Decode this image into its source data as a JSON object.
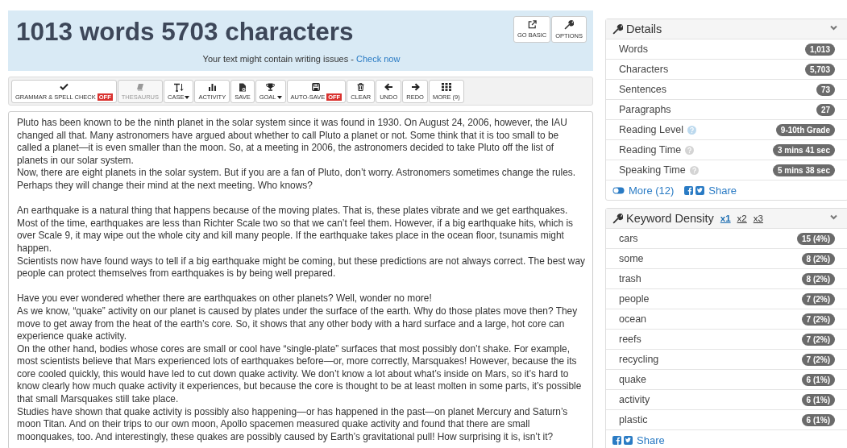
{
  "header": {
    "title": "1013 words 5703 characters",
    "notice": "Your text might contain writing issues - ",
    "notice_link": "Check now",
    "buttons": [
      {
        "label": "GO BASIC"
      },
      {
        "label": "OPTIONS"
      }
    ]
  },
  "toolbar": [
    {
      "label": "GRAMMAR & SPELL CHECK",
      "badge": "OFF",
      "dropdown": false,
      "disabled": false
    },
    {
      "label": "THESAURUS",
      "dropdown": false,
      "disabled": true
    },
    {
      "label": "CASE",
      "dropdown": true,
      "disabled": false
    },
    {
      "label": "ACTIVITY",
      "dropdown": false,
      "disabled": false
    },
    {
      "label": "SAVE",
      "dropdown": false,
      "disabled": false
    },
    {
      "label": "GOAL",
      "dropdown": true,
      "disabled": false
    },
    {
      "label": "AUTO-SAVE",
      "badge": "OFF",
      "dropdown": false,
      "disabled": false
    },
    {
      "label": "CLEAR",
      "dropdown": false,
      "disabled": false
    },
    {
      "label": "UNDO",
      "dropdown": false,
      "disabled": false
    },
    {
      "label": "REDO",
      "dropdown": false,
      "disabled": false
    },
    {
      "label": "MORE (9)",
      "dropdown": false,
      "disabled": false
    }
  ],
  "editor": {
    "blocks": [
      [
        "Pluto has been known to be the ninth planet in the solar system since it was found in 1930. On August 24, 2006, however, the IAU changed all that. Many astronomers have argued about whether to call Pluto a planet or not. Some think that it is too small to be called a planet—it is even smaller than the moon. So, at a meeting in 2006, the astronomers decided to take Pluto off the list of planets in our solar system.",
        "Now, there are eight planets in the solar system. But if you are a fan of Pluto, don’t worry. Astronomers sometimes change the rules. Perhaps they will change their mind at the next meeting. Who knows?"
      ],
      [
        "An earthquake is a natural thing that happens because of the moving plates. That is, these plates vibrate and we get earthquakes. Most of the time, earthquakes are less than Richter Scale two so that we can’t feel them. However, if a big earthquake hits, which is over Scale 9, it may wipe out the whole city and kill many people. If the earthquake takes place in the ocean floor, tsunamis might happen.",
        "Scientists now have found ways to tell if a big earthquake might be coming, but these predictions are not always correct. The best way people can protect themselves from earthquakes is by being well prepared."
      ],
      [
        "Have you ever wondered whether there are earthquakes on other planets? Well, wonder no more!",
        "As we know, “quake” activity on our planet is caused by plates under the surface of the earth. Why do those plates move then? They move to get away from the heat of the earth’s core. So, it shows that any other body with a hard surface and a large, hot core can experience quake activity.",
        "On the other hand, bodies whose cores are small or cool have “single-plate” surfaces that most possibly don’t shake. For example, most scientists believe that Mars experienced lots of earthquakes before—or, more correctly, Marsquakes! However, because the its core cooled quickly, this would have led to cut down quake activity. We don’t know a lot about what’s inside on Mars, so it’s hard to know clearly how much quake activity it experiences, but because the core is thought to be at least molten in some parts, it’s possible that small Marsquakes still take place.",
        "Studies have shown that quake activity is possibly also happening—or has happened in the past—on planet Mercury and Saturn’s moon Titan. And on their trips to our own moon, Apollo spacemen measured quake activity and found that there are small moonquakes, too. And interestingly, these quakes are possibly caused by Earth’s gravitational pull! How surprising it is, isn’t it?"
      ]
    ]
  },
  "details": {
    "title": "Details",
    "rows": [
      {
        "label": "Words",
        "value": "1,013",
        "help": false
      },
      {
        "label": "Characters",
        "value": "5,703",
        "help": false
      },
      {
        "label": "Sentences",
        "value": "73",
        "help": false
      },
      {
        "label": "Paragraphs",
        "value": "27",
        "help": false
      },
      {
        "label": "Reading Level",
        "value": "9-10th Grade",
        "help": true
      },
      {
        "label": "Reading Time",
        "value": "3 mins 41 sec",
        "help": true
      },
      {
        "label": "Speaking Time",
        "value": "5 mins 38 sec",
        "help": true
      }
    ],
    "more": "More (12)",
    "share": "Share"
  },
  "keywords": {
    "title": "Keyword Density",
    "tabs": [
      {
        "label": "x1",
        "selected": true
      },
      {
        "label": "x2",
        "selected": false
      },
      {
        "label": "x3",
        "selected": false
      }
    ],
    "rows": [
      {
        "label": "cars",
        "value": "15 (4%)"
      },
      {
        "label": "some",
        "value": "8 (2%)"
      },
      {
        "label": "trash",
        "value": "8 (2%)"
      },
      {
        "label": "people",
        "value": "7 (2%)"
      },
      {
        "label": "ocean",
        "value": "7 (2%)"
      },
      {
        "label": "reefs",
        "value": "7 (2%)"
      },
      {
        "label": "recycling",
        "value": "7 (2%)"
      },
      {
        "label": "quake",
        "value": "6 (1%)"
      },
      {
        "label": "activity",
        "value": "6 (1%)"
      },
      {
        "label": "plastic",
        "value": "6 (1%)"
      }
    ],
    "share": "Share"
  }
}
